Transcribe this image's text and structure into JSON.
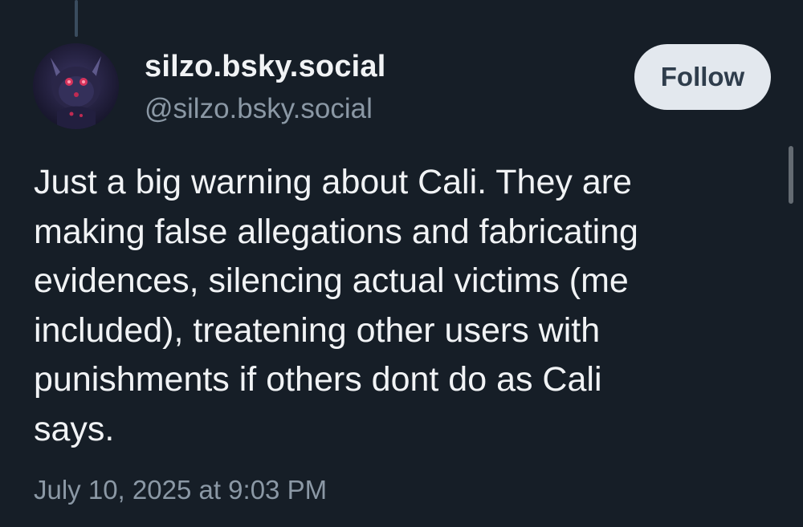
{
  "post": {
    "author": {
      "display_name": "silzo.bsky.social",
      "handle": "@silzo.bsky.social",
      "avatar_icon": "avatar-image"
    },
    "follow_label": "Follow",
    "text_lines": [
      "Just a big warning about Cali. They are",
      "making false allegations and fabricating",
      "evidences, silencing actual victims (me",
      "included), treatening other users with",
      "punishments if others dont do as Cali",
      "says."
    ],
    "timestamp": "July 10, 2025 at 9:03 PM"
  },
  "colors": {
    "background": "#161e27",
    "text_primary": "#f1f3f5",
    "text_secondary": "#8b98a5",
    "follow_button_bg": "#e3e8ee",
    "follow_button_text": "#2f3d4c",
    "thread_line": "#3a4c5e"
  }
}
